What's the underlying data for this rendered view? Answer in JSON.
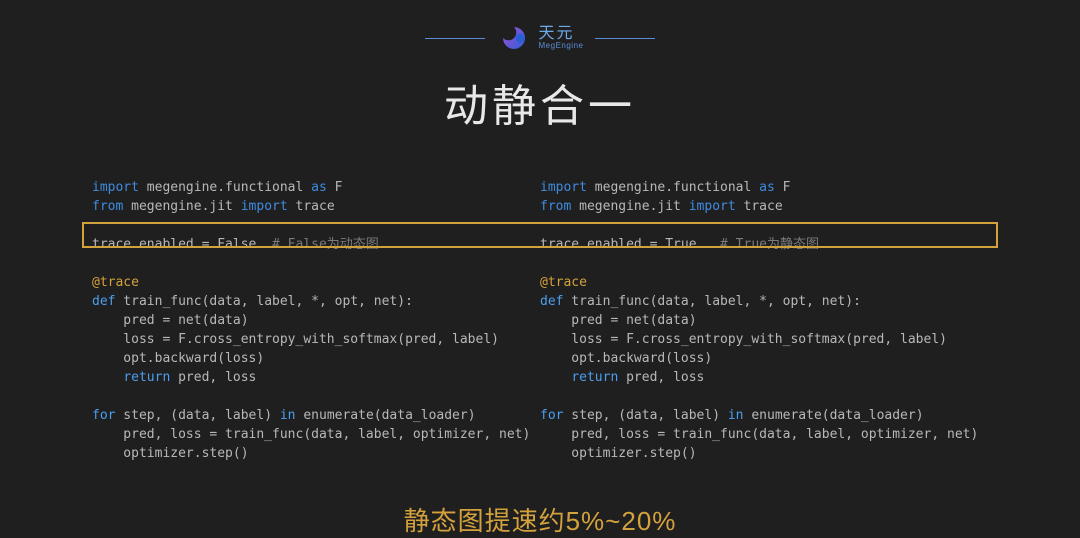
{
  "brand": {
    "cn": "天元",
    "en": "MegEngine"
  },
  "title": "动静合一",
  "code": {
    "left": {
      "l1_kw1": "import",
      "l1_txt": " megengine.functional ",
      "l1_kw2": "as",
      "l1_tail": " F",
      "l2_kw1": "from",
      "l2_txt": " megengine.jit ",
      "l2_kw2": "import",
      "l2_tail": " trace",
      "l4": "trace.enabled = False  ",
      "l4_cm": "# False为动态图",
      "l6_dec": "@trace",
      "l7_kw": "def",
      "l7_txt": " train_func(data, label, *, opt, net):",
      "l8": "    pred = net(data)",
      "l9": "    loss = F.cross_entropy_with_softmax(pred, label)",
      "l10": "    opt.backward(loss)",
      "l11_pad": "    ",
      "l11_kw": "return",
      "l11_txt": " pred, loss",
      "l13_kw": "for",
      "l13_txt": " step, (data, label) ",
      "l13_kw2": "in",
      "l13_tail": " enumerate(data_loader)",
      "l14": "    pred, loss = train_func(data, label, optimizer, net)",
      "l15": "    optimizer.step()"
    },
    "right": {
      "l1_kw1": "import",
      "l1_txt": " megengine.functional ",
      "l1_kw2": "as",
      "l1_tail": " F",
      "l2_kw1": "from",
      "l2_txt": " megengine.jit ",
      "l2_kw2": "import",
      "l2_tail": " trace",
      "l4": "trace.enabled = True   ",
      "l4_cm": "# True为静态图",
      "l6_dec": "@trace",
      "l7_kw": "def",
      "l7_txt": " train_func(data, label, *, opt, net):",
      "l8": "    pred = net(data)",
      "l9": "    loss = F.cross_entropy_with_softmax(pred, label)",
      "l10": "    opt.backward(loss)",
      "l11_pad": "    ",
      "l11_kw": "return",
      "l11_txt": " pred, loss",
      "l13_kw": "for",
      "l13_txt": " step, (data, label) ",
      "l13_kw2": "in",
      "l13_tail": " enumerate(data_loader)",
      "l14": "    pred, loss = train_func(data, label, optimizer, net)",
      "l15": "    optimizer.step()"
    }
  },
  "footer": "静态图提速约5%~20%"
}
